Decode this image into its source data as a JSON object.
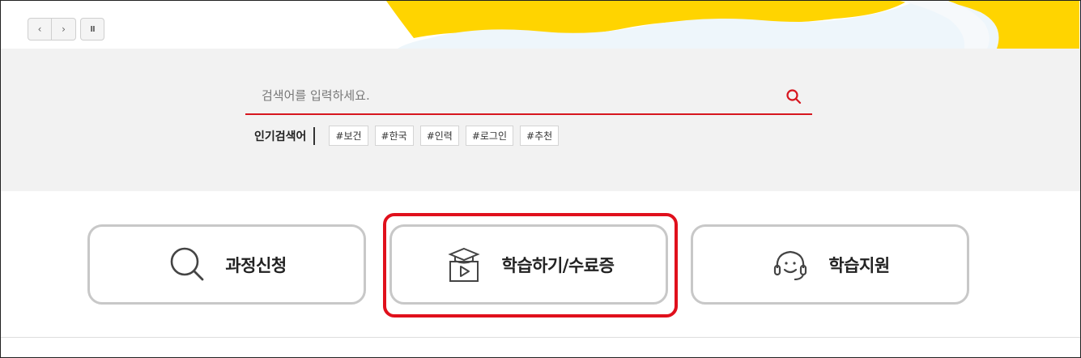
{
  "slider": {
    "prev_icon": "chevron-left-icon",
    "next_icon": "chevron-right-icon",
    "pause_icon": "pause-icon",
    "prev_glyph": "‹",
    "next_glyph": "›",
    "pause_glyph": "II"
  },
  "search": {
    "placeholder": "검색어를 입력하세요.",
    "value": "",
    "button_icon": "search-icon",
    "accent_color": "#d7161f"
  },
  "popular": {
    "label": "인기검색어",
    "tags": [
      "#보건",
      "#한국",
      "#인력",
      "#로그인",
      "#추천"
    ]
  },
  "quick_menu": {
    "items": [
      {
        "label": "과정신청",
        "icon": "magnifier-icon"
      },
      {
        "label": "학습하기/수료증",
        "icon": "graduation-video-icon"
      },
      {
        "label": "학습지원",
        "icon": "headset-icon"
      }
    ],
    "highlight_color": "#e0101c"
  },
  "colors": {
    "banner_yellow": "#ffd400",
    "search_bg": "#f2f2f2",
    "card_border": "#c8c8c8"
  }
}
